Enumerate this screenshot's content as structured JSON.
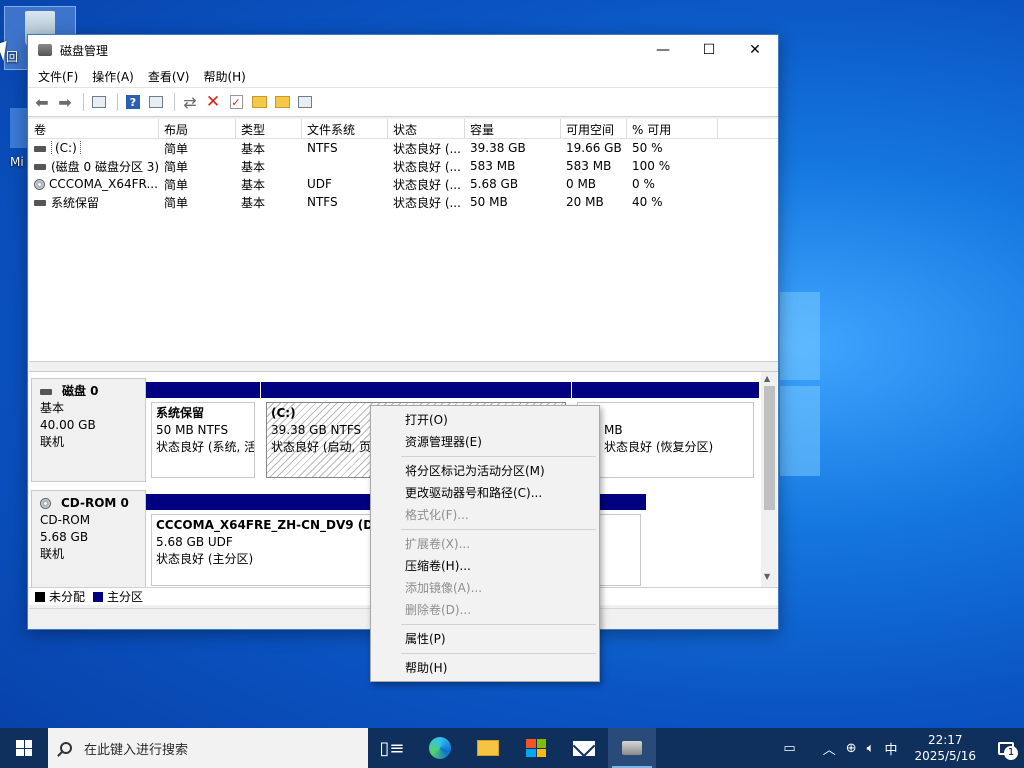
{
  "desktop": {
    "icon_label_1": "回",
    "icon_label_2": "Mi"
  },
  "window": {
    "title": "磁盘管理",
    "controls": {
      "minimize": "—",
      "maximize": "☐",
      "close": "✕"
    },
    "menu": [
      "文件(F)",
      "操作(A)",
      "查看(V)",
      "帮助(H)"
    ],
    "columns": [
      "卷",
      "布局",
      "类型",
      "文件系统",
      "状态",
      "容量",
      "可用空间",
      "% 可用"
    ],
    "volumes": [
      {
        "name": "(C:)",
        "layout": "简单",
        "type": "基本",
        "fs": "NTFS",
        "status": "状态良好 (...",
        "capacity": "39.38 GB",
        "free": "19.66 GB",
        "pct": "50 %",
        "icon": "drive-icon"
      },
      {
        "name": "(磁盘 0 磁盘分区 3)",
        "layout": "简单",
        "type": "基本",
        "fs": "",
        "status": "状态良好 (...",
        "capacity": "583 MB",
        "free": "583 MB",
        "pct": "100 %",
        "icon": "drive-icon"
      },
      {
        "name": "CCCOMA_X64FR...",
        "layout": "简单",
        "type": "基本",
        "fs": "UDF",
        "status": "状态良好 (...",
        "capacity": "5.68 GB",
        "free": "0 MB",
        "pct": "0 %",
        "icon": "cd-icon"
      },
      {
        "name": "系统保留",
        "layout": "简单",
        "type": "基本",
        "fs": "NTFS",
        "status": "状态良好 (...",
        "capacity": "50 MB",
        "free": "20 MB",
        "pct": "40 %",
        "icon": "drive-icon"
      }
    ],
    "disks": [
      {
        "name": "磁盘 0",
        "kind": "基本",
        "size": "40.00 GB",
        "state": "联机",
        "partitions": [
          {
            "title": "系统保留",
            "line2": "50 MB NTFS",
            "line3": "状态良好 (系统, 活"
          },
          {
            "title": "(C:)",
            "line2": "39.38 GB NTFS",
            "line3": "状态良好 (启动, 页"
          },
          {
            "title": "",
            "line2": "MB",
            "line3": "状态良好 (恢复分区)"
          }
        ]
      },
      {
        "name": "CD-ROM 0",
        "kind": "CD-ROM",
        "size": "5.68 GB",
        "state": "联机",
        "partitions": [
          {
            "title": "CCCOMA_X64FRE_ZH-CN_DV9  (D:)",
            "line2": "5.68 GB UDF",
            "line3": "状态良好 (主分区)"
          }
        ]
      }
    ],
    "legend": {
      "unallocated": "未分配",
      "primary": "主分区",
      "unallocated_color": "#000000",
      "primary_color": "#000080"
    }
  },
  "context_menu": {
    "items": [
      {
        "label": "打开(O)",
        "disabled": false
      },
      {
        "label": "资源管理器(E)",
        "disabled": false
      },
      {
        "sep": true
      },
      {
        "label": "将分区标记为活动分区(M)",
        "disabled": false
      },
      {
        "label": "更改驱动器号和路径(C)...",
        "disabled": false
      },
      {
        "label": "格式化(F)...",
        "disabled": true
      },
      {
        "sep": true
      },
      {
        "label": "扩展卷(X)...",
        "disabled": true
      },
      {
        "label": "压缩卷(H)...",
        "disabled": false
      },
      {
        "label": "添加镜像(A)...",
        "disabled": true
      },
      {
        "label": "删除卷(D)...",
        "disabled": true
      },
      {
        "sep": true
      },
      {
        "label": "属性(P)",
        "disabled": false
      },
      {
        "sep": true
      },
      {
        "label": "帮助(H)",
        "disabled": false
      }
    ]
  },
  "taskbar": {
    "search_placeholder": "在此键入进行搜索",
    "ime": "中",
    "time": "22:17",
    "date": "2025/5/16",
    "notification_count": "1"
  }
}
